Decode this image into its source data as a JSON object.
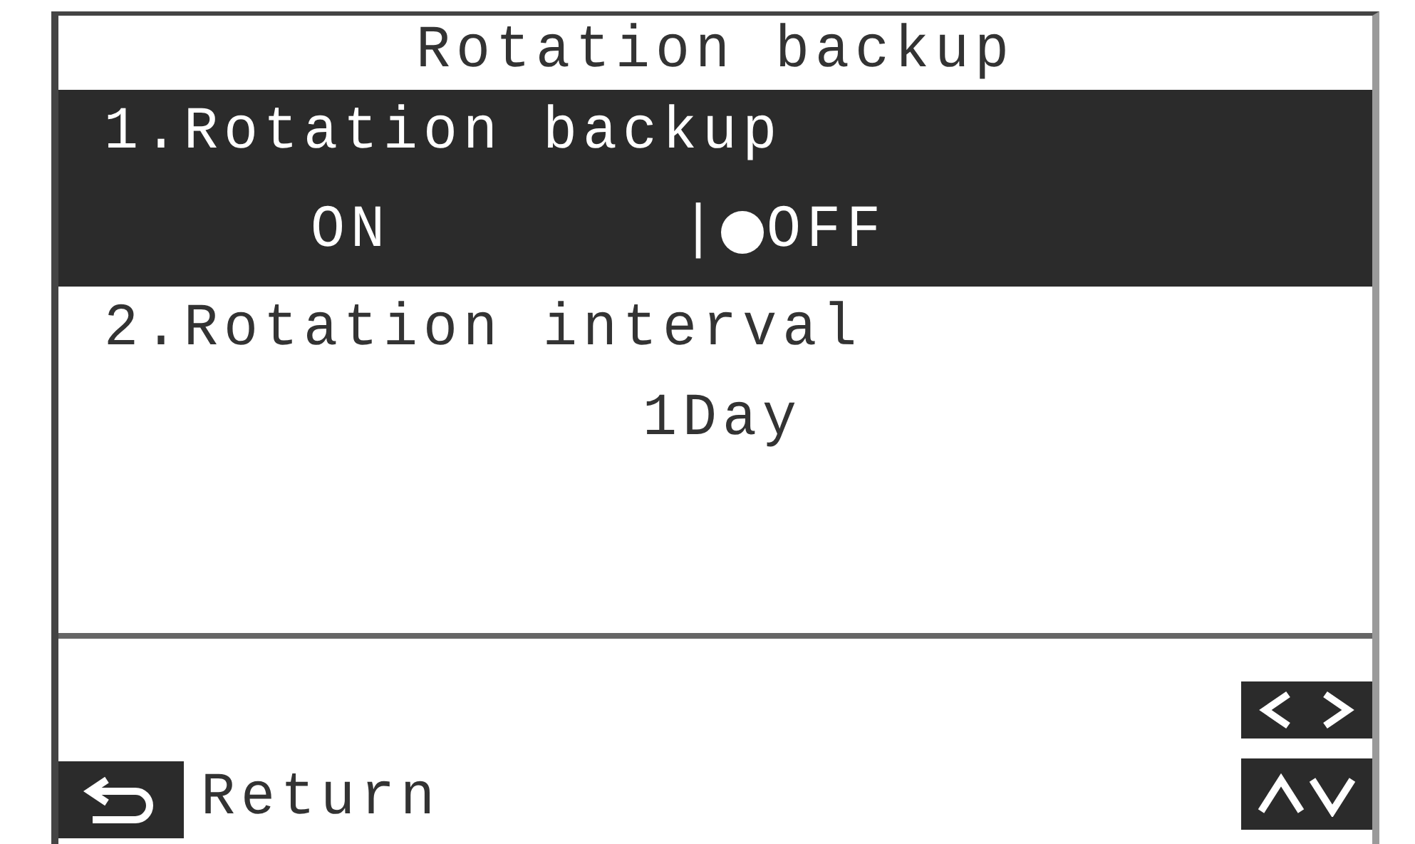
{
  "screen": {
    "title": "Rotation backup"
  },
  "items": [
    {
      "kind": "toggle",
      "label": "1.Rotation backup",
      "selected": true,
      "separator": "|",
      "options": [
        {
          "label": "ON",
          "selected": false
        },
        {
          "label": "OFF",
          "selected": true
        }
      ]
    },
    {
      "kind": "value",
      "label": "2.Rotation interval",
      "selected": false,
      "value": "1Day"
    }
  ],
  "footer": {
    "return_label": "Return"
  }
}
